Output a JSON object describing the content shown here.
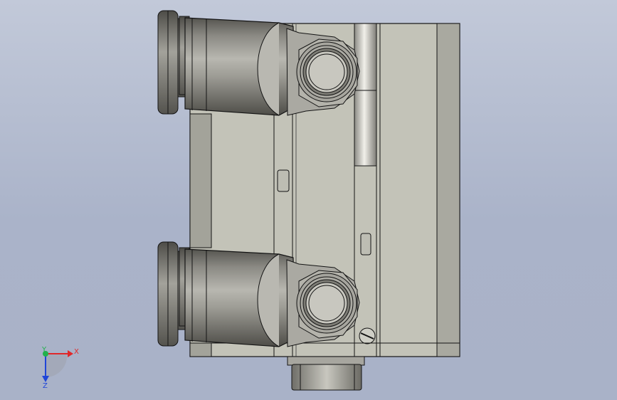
{
  "window": {
    "title": ""
  },
  "model": {
    "name": "",
    "colors": {
      "body": "#c3c3b8",
      "body_dark": "#8e8e86",
      "edge": "#141414",
      "fitting_dark": "#6d6c66",
      "fitting_light": "#a9a8a0",
      "background_top": "#c2c9d9",
      "background_bottom": "#a9b2c8"
    }
  },
  "triad": {
    "x_label": "X",
    "y_label": "Y",
    "z_label": "Z",
    "x_color": "#e0282a",
    "y_color": "#22b14c",
    "z_color": "#2046d8"
  }
}
